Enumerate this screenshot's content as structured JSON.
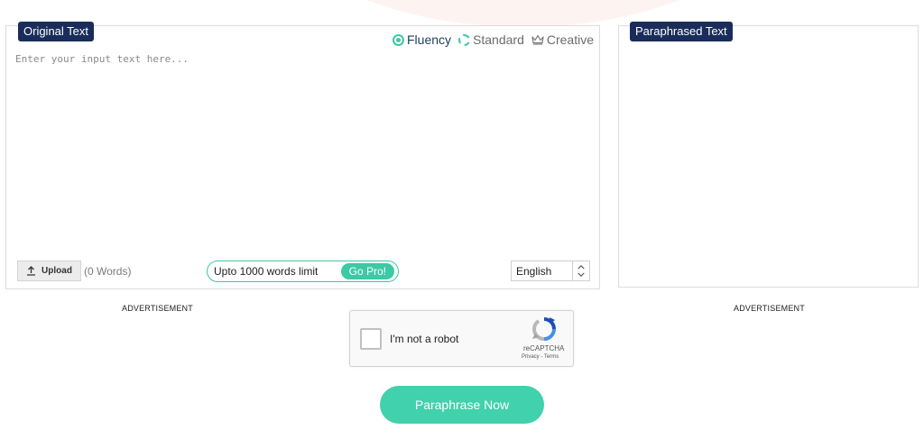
{
  "original_panel": {
    "title": "Original Text",
    "modes": [
      {
        "label": "Fluency",
        "active": true
      },
      {
        "label": "Standard",
        "active": false
      },
      {
        "label": "Creative",
        "active": false
      }
    ],
    "placeholder": "Enter your input text here...",
    "upload_label": "Upload",
    "word_count": "(0 Words)",
    "limit_text": "Upto 1000 words limit",
    "go_pro_label": "Go Pro!",
    "language": "English"
  },
  "paraphrased_panel": {
    "title": "Paraphrased Text"
  },
  "ads": {
    "left": "ADVERTISEMENT",
    "right": "ADVERTISEMENT"
  },
  "recaptcha": {
    "label": "I'm not a robot",
    "brand": "reCAPTCHA",
    "privacy": "Privacy",
    "separator": " - ",
    "terms": "Terms"
  },
  "action": {
    "paraphrase_label": "Paraphrase Now"
  },
  "colors": {
    "accent": "#3cc9a5",
    "tag_bg": "#1a2d5a",
    "button": "#41d1ac"
  }
}
